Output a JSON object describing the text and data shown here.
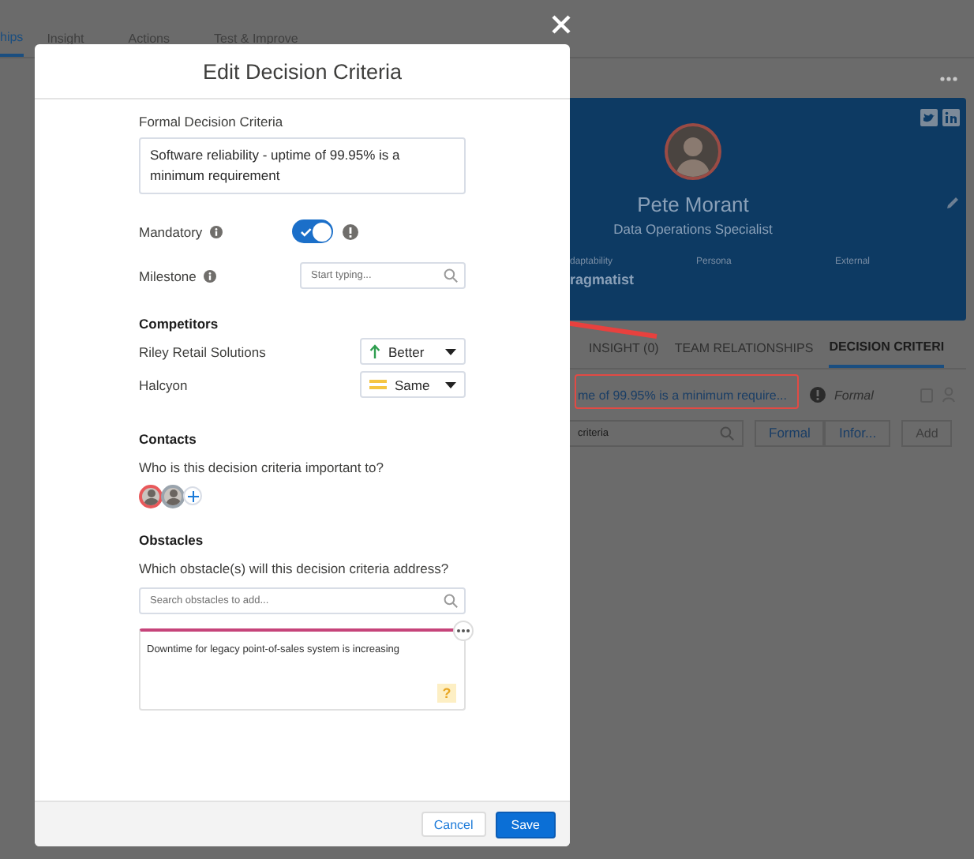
{
  "background": {
    "tabs": [
      {
        "label": "hips",
        "selected": true
      },
      {
        "label": "Insight",
        "selected": false
      },
      {
        "label": "Actions",
        "selected": false
      },
      {
        "label": "Test & Improve",
        "selected": false
      }
    ],
    "profile": {
      "name": "Pete Morant",
      "title": "Data Operations Specialist",
      "fields": [
        {
          "label": "daptability",
          "value": "ragmatist"
        },
        {
          "label": "Persona"
        },
        {
          "label": "External"
        }
      ]
    },
    "detail_tabs": [
      {
        "label": "INSIGHT (0)",
        "selected": false
      },
      {
        "label": "TEAM RELATIONSHIPS",
        "selected": false
      },
      {
        "label": "DECISION CRITERI",
        "selected": true
      }
    ],
    "criteria_row": {
      "text": "me of 99.95% is a minimum require...",
      "type": "Formal"
    },
    "search": {
      "value": "criteria"
    },
    "filter_buttons": [
      "Formal",
      "Infor..."
    ],
    "add_button": {
      "label": "Add",
      "disabled": true
    }
  },
  "modal": {
    "title": "Edit Decision Criteria",
    "criteria": {
      "label": "Formal Decision Criteria",
      "value": "Software reliability - uptime of 99.95% is a minimum requirement"
    },
    "mandatory": {
      "label": "Mandatory",
      "on": true
    },
    "milestone": {
      "label": "Milestone",
      "placeholder": "Start typing..."
    },
    "competitors": {
      "heading": "Competitors",
      "items": [
        {
          "name": "Riley Retail Solutions",
          "rating": "Better",
          "kind": "better"
        },
        {
          "name": "Halcyon",
          "rating": "Same",
          "kind": "same"
        }
      ]
    },
    "contacts": {
      "heading": "Contacts",
      "question": "Who is this decision criteria important to?",
      "people": [
        {
          "color": "#e8595b"
        },
        {
          "color": "#9aa4ad"
        }
      ]
    },
    "obstacles": {
      "heading": "Obstacles",
      "question": "Which obstacle(s) will this decision criteria address?",
      "placeholder": "Search obstacles to add...",
      "items": [
        {
          "text": "Downtime for legacy point-of-sales system is increasing",
          "color": "#c6447a",
          "badge": "?"
        }
      ]
    },
    "buttons": {
      "cancel": "Cancel",
      "save": "Save"
    }
  }
}
